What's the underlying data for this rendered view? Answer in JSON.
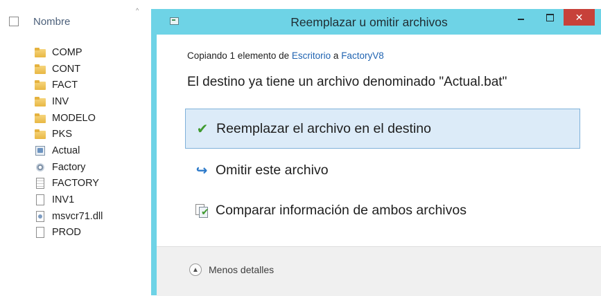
{
  "explorer": {
    "column_header": "Nombre",
    "sort_indicator": "^",
    "items": [
      {
        "name": "COMP",
        "icon": "folder-icon"
      },
      {
        "name": "CONT",
        "icon": "folder-icon"
      },
      {
        "name": "FACT",
        "icon": "folder-icon"
      },
      {
        "name": "INV",
        "icon": "folder-icon"
      },
      {
        "name": "MODELO",
        "icon": "folder-icon"
      },
      {
        "name": "PKS",
        "icon": "folder-icon"
      },
      {
        "name": "Actual",
        "icon": "shortcut-icon"
      },
      {
        "name": "Factory",
        "icon": "gear-icon"
      },
      {
        "name": "FACTORY",
        "icon": "text-file-icon"
      },
      {
        "name": "INV1",
        "icon": "file-icon"
      },
      {
        "name": "msvcr71.dll",
        "icon": "dll-icon"
      },
      {
        "name": "PROD",
        "icon": "file-icon"
      }
    ]
  },
  "dialog": {
    "title": "Reemplazar u omitir archivos",
    "close_glyph": "✕",
    "copy_prefix": "Copiando 1 elemento de",
    "copy_source": "Escritorio",
    "copy_mid": "a",
    "copy_dest": "FactoryV8",
    "heading": "El destino ya tiene un archivo denominado \"Actual.bat\"",
    "options": {
      "replace": "Reemplazar el archivo en el destino",
      "skip": "Omitir este archivo",
      "compare": "Comparar información de ambos archivos"
    },
    "details_label": "Menos detalles"
  },
  "colors": {
    "title_bar": "#6ed3e6",
    "close_button": "#c7413a",
    "selected_option_bg": "#dcebf8",
    "link": "#1f63b1"
  }
}
